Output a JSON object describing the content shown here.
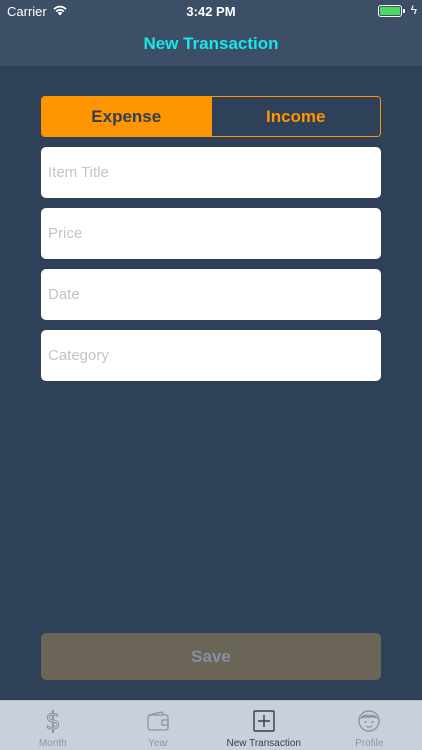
{
  "status_bar": {
    "carrier": "Carrier",
    "time": "3:42 PM",
    "battery_level": 1.0
  },
  "nav": {
    "title": "New Transaction"
  },
  "segment": {
    "options": [
      {
        "label": "Expense",
        "selected": true
      },
      {
        "label": "Income",
        "selected": false
      }
    ]
  },
  "form": {
    "item_title_placeholder": "Item Title",
    "price_placeholder": "Price",
    "date_placeholder": "Date",
    "category_placeholder": "Category"
  },
  "save_label": "Save",
  "tabs": [
    {
      "label": "Month",
      "icon": "dollar-icon",
      "active": false
    },
    {
      "label": "Year",
      "icon": "wallet-icon",
      "active": false
    },
    {
      "label": "New Transaction",
      "icon": "plus-square-icon",
      "active": true
    },
    {
      "label": "Profile",
      "icon": "face-icon",
      "active": false
    }
  ],
  "colors": {
    "background": "#2f4159",
    "accent": "#ff9500",
    "title": "#19e6ea",
    "save_disabled": "#6b6557"
  }
}
